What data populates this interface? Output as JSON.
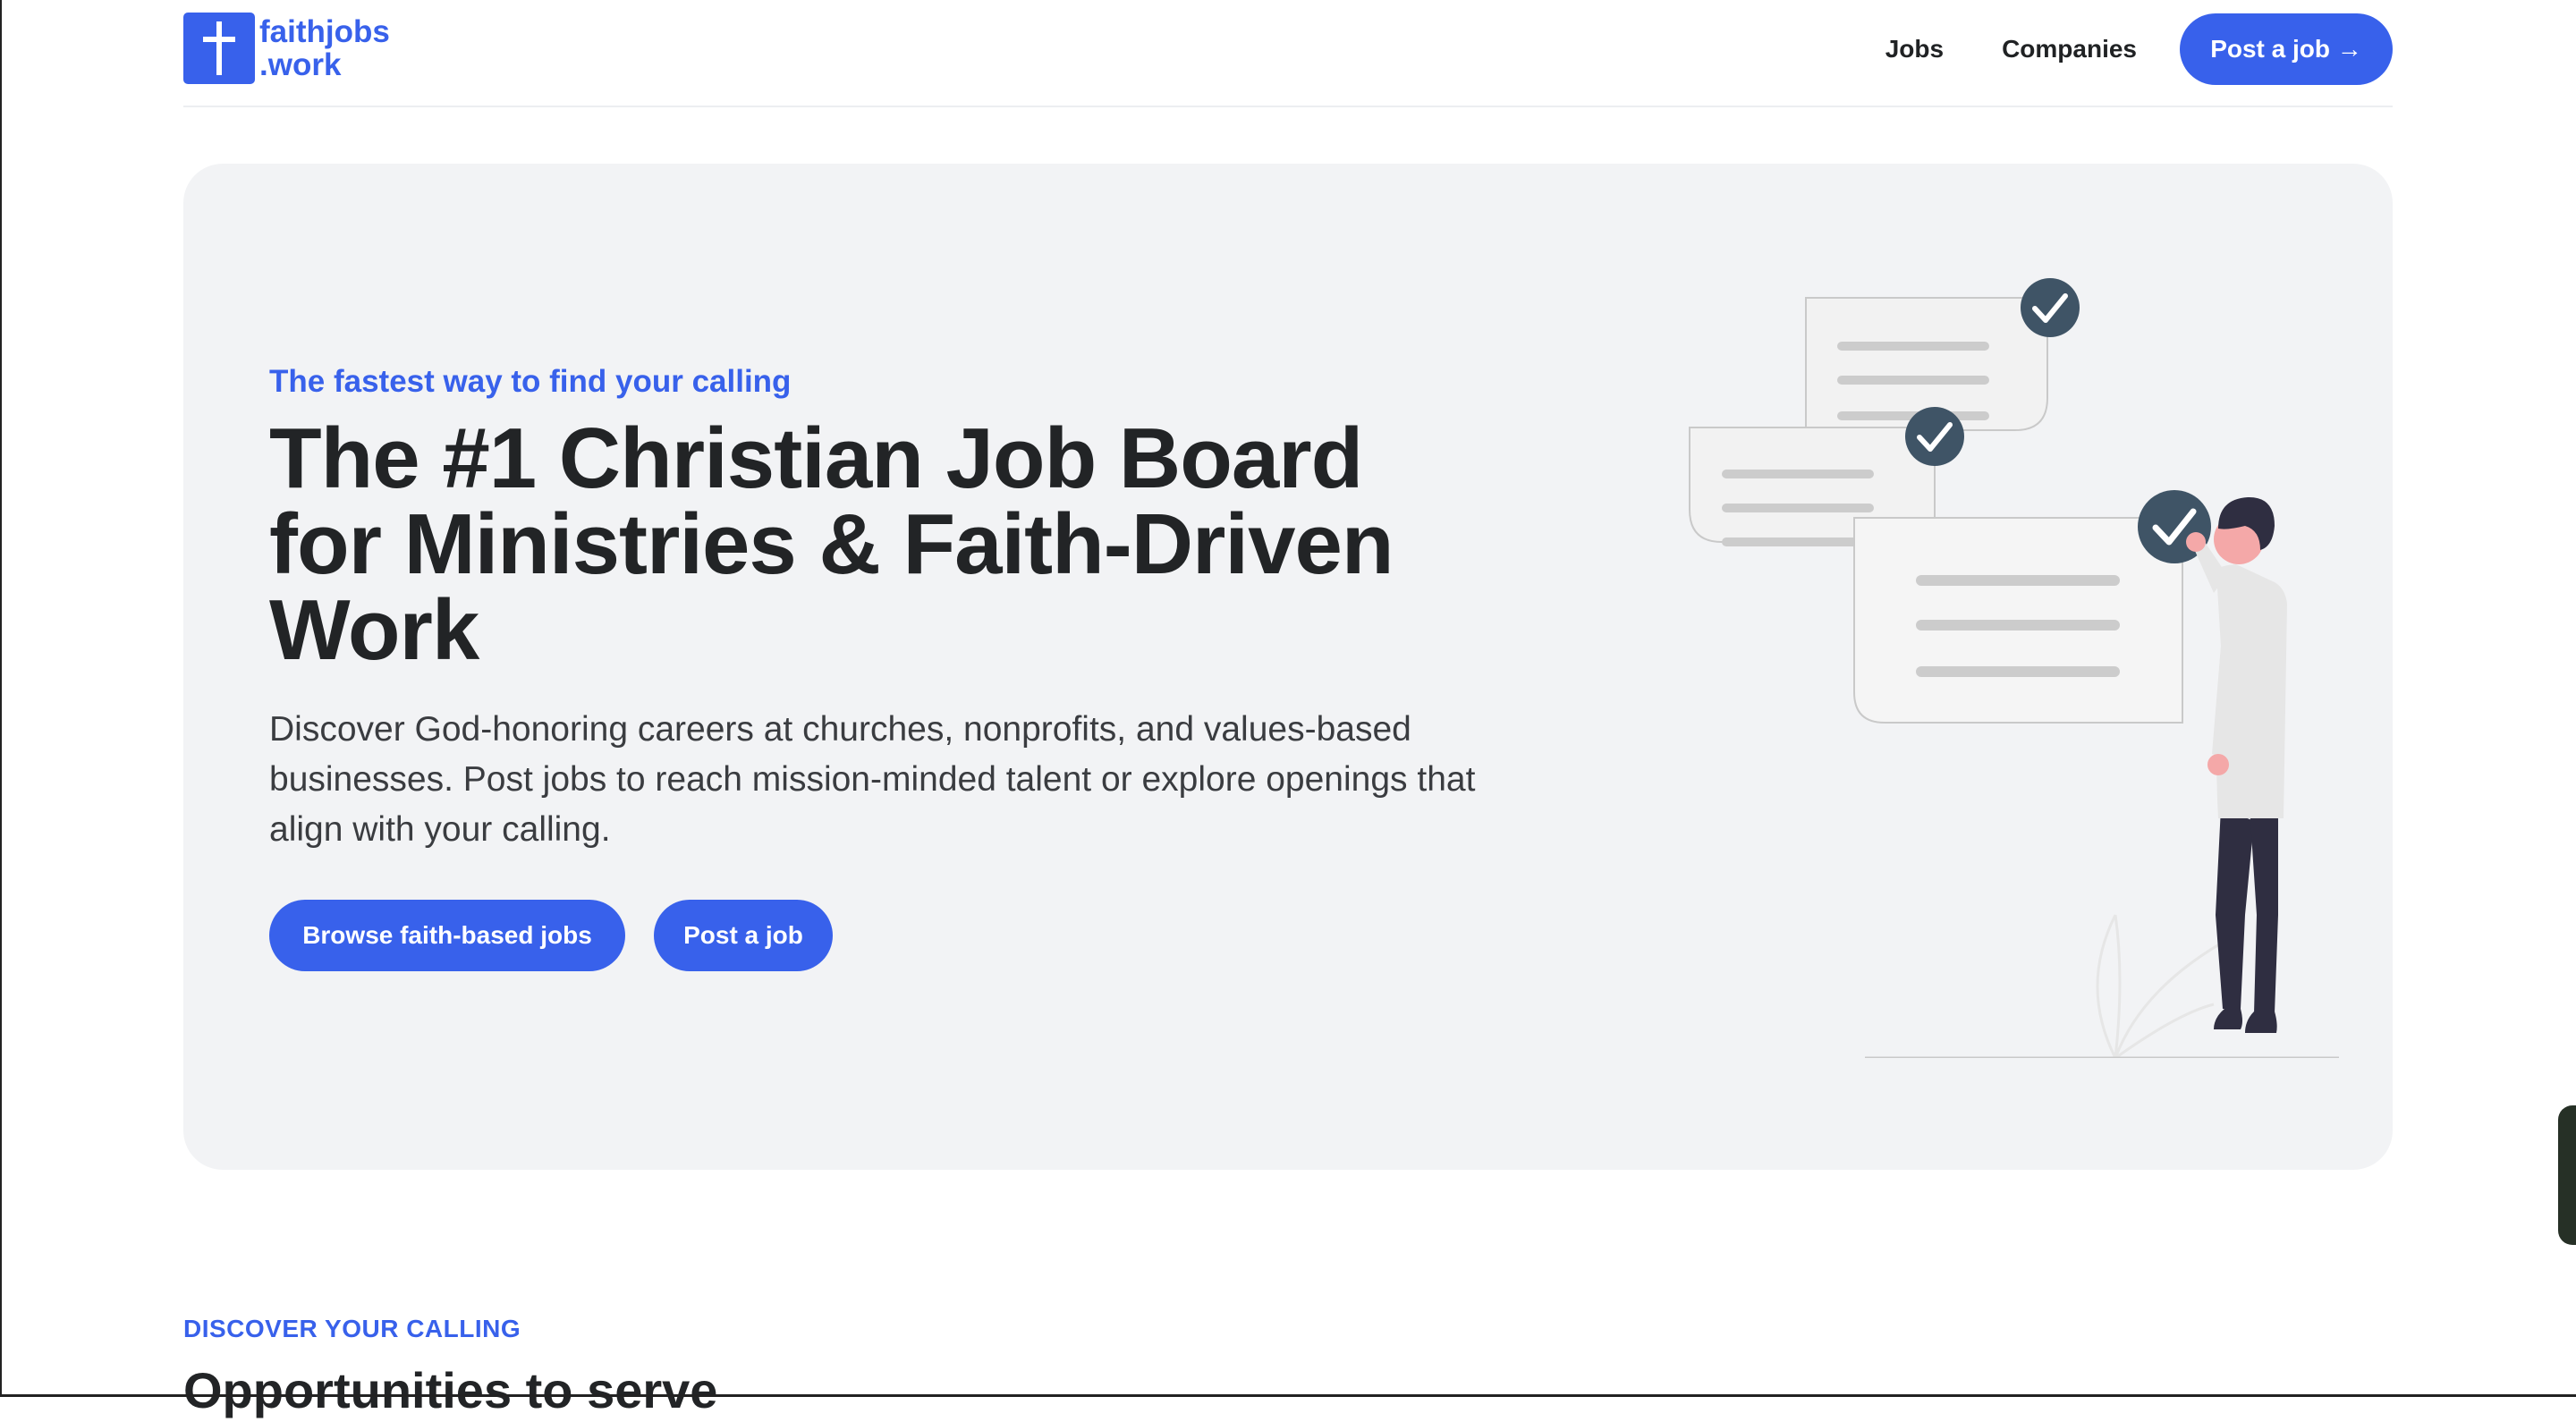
{
  "header": {
    "logo_line1": "faithjobs",
    "logo_line2": ".work",
    "logo_icon": "cross-icon",
    "nav": {
      "jobs": "Jobs",
      "companies": "Companies",
      "post_job": "Post a job →"
    }
  },
  "hero": {
    "tagline": "The fastest way to find your calling",
    "headline": "The #1 Christian Job Board for Ministries & Faith-Driven Work",
    "description": "Discover God-honoring careers at churches, nonprofits, and values-based businesses. Post jobs to reach mission-minded talent or explore openings that align with your calling.",
    "primary_cta": "Browse faith-based jobs",
    "secondary_cta": "Post a job",
    "illustration_icon": "checklist-person-illustration"
  },
  "section": {
    "eyebrow": "DISCOVER YOUR CALLING",
    "title": "Opportunities to serve"
  },
  "colors": {
    "accent": "#3861eb",
    "text": "#222426",
    "hero_bg": "#f2f3f5",
    "check_badge": "#3f5466"
  }
}
